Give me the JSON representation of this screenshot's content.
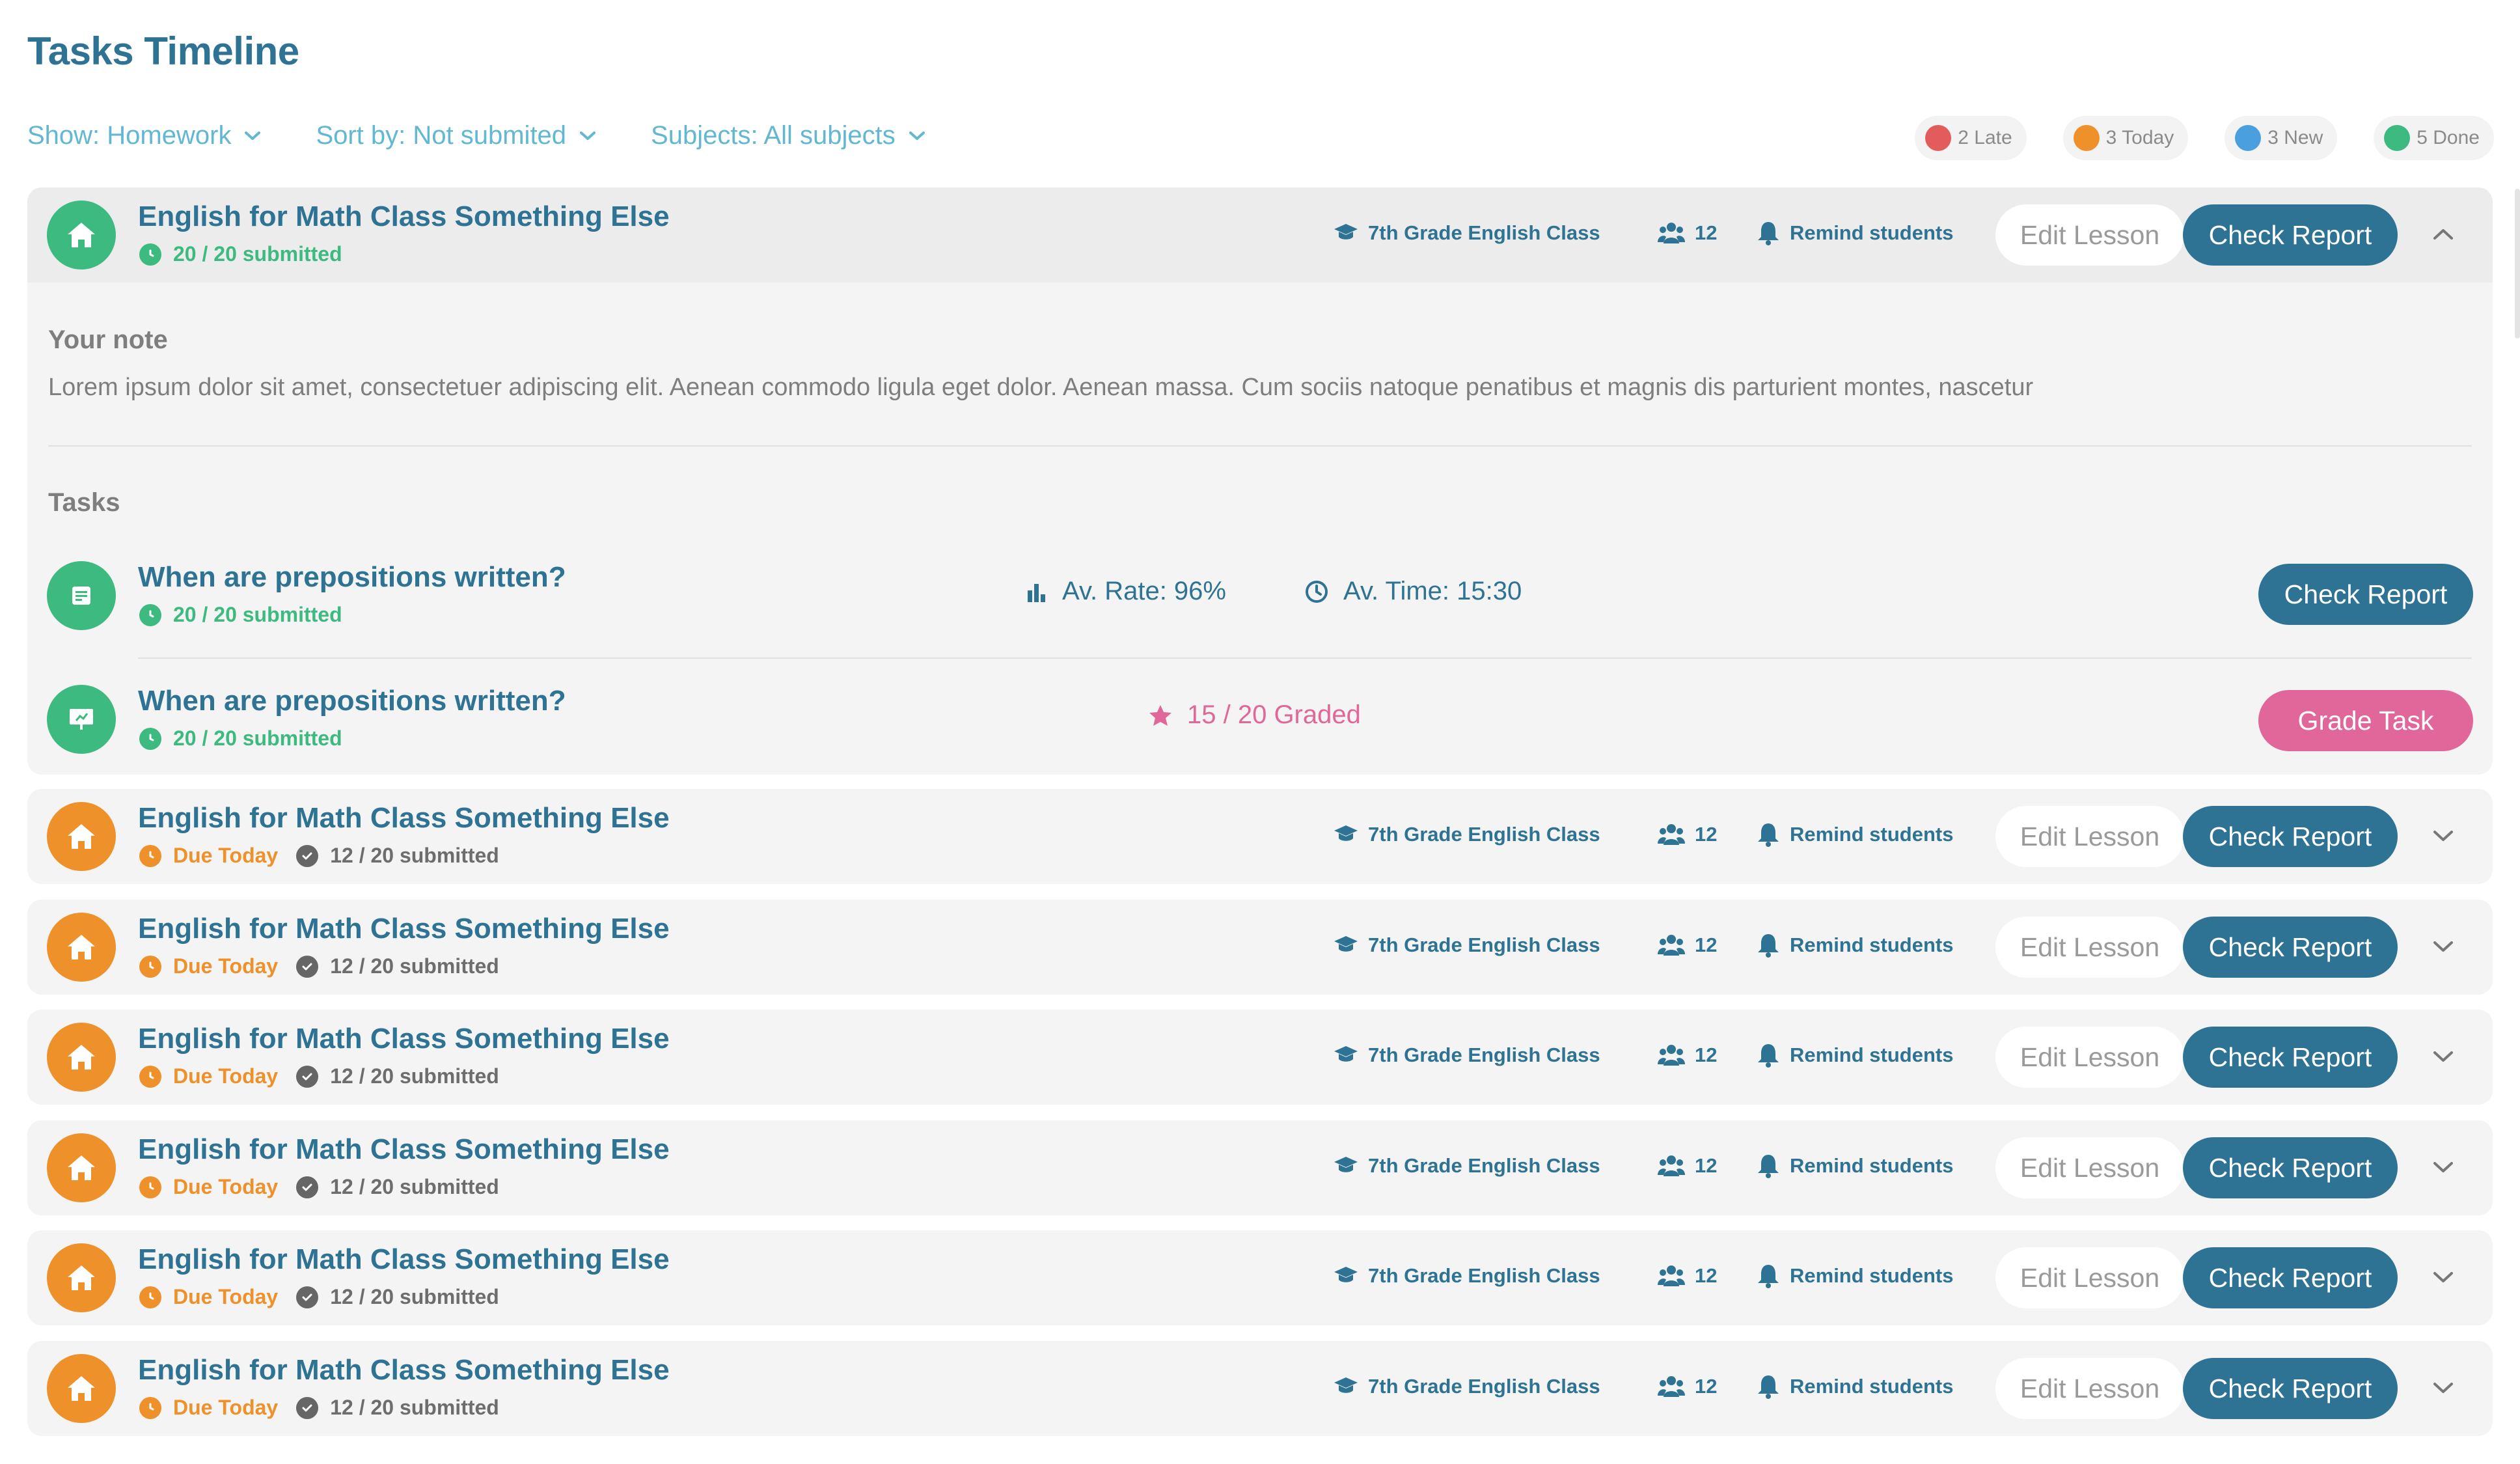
{
  "page_title": "Tasks Timeline",
  "filters": {
    "show": "Show: Homework",
    "sort": "Sort by: Not submited",
    "subjects": "Subjects: All subjects"
  },
  "legend": [
    {
      "label": "2 Late",
      "color": "#e45b5b"
    },
    {
      "label": "3 Today",
      "color": "#ee912b"
    },
    {
      "label": "3 New",
      "color": "#4a9fde"
    },
    {
      "label": "5 Done",
      "color": "#3dba7f"
    }
  ],
  "expanded_lesson": {
    "title": "English for Math Class Something Else",
    "submitted": "20 / 20 submitted",
    "class_name": "7th Grade English Class",
    "students": "12",
    "remind": "Remind students",
    "edit_label": "Edit Lesson",
    "check_label": "Check Report",
    "note_label": "Your note",
    "note_text": "Lorem ipsum dolor sit amet, consectetuer adipiscing elit. Aenean commodo ligula eget dolor. Aenean massa. Cum sociis natoque penatibus et magnis dis parturient montes, nascetur",
    "tasks_label": "Tasks",
    "tasks": [
      {
        "title": "When are prepositions written?",
        "submitted": "20 / 20 submitted",
        "rate": "Av. Rate: 96%",
        "time": "Av. Time: 15:30",
        "button": "Check Report"
      },
      {
        "title": "When are prepositions written?",
        "submitted": "20 / 20 submitted",
        "graded": "15 / 20 Graded",
        "button": "Grade Task"
      }
    ]
  },
  "lessons": [
    {
      "title": "English for Math Class Something Else",
      "due": "Due Today",
      "submitted": "12 / 20 submitted",
      "class_name": "7th Grade English Class",
      "students": "12",
      "remind": "Remind students",
      "edit_label": "Edit Lesson",
      "check_label": "Check Report"
    },
    {
      "title": "English for Math Class Something Else",
      "due": "Due Today",
      "submitted": "12 / 20 submitted",
      "class_name": "7th Grade English Class",
      "students": "12",
      "remind": "Remind students",
      "edit_label": "Edit Lesson",
      "check_label": "Check Report"
    },
    {
      "title": "English for Math Class Something Else",
      "due": "Due Today",
      "submitted": "12 / 20 submitted",
      "class_name": "7th Grade English Class",
      "students": "12",
      "remind": "Remind students",
      "edit_label": "Edit Lesson",
      "check_label": "Check Report"
    },
    {
      "title": "English for Math Class Something Else",
      "due": "Due Today",
      "submitted": "12 / 20 submitted",
      "class_name": "7th Grade English Class",
      "students": "12",
      "remind": "Remind students",
      "edit_label": "Edit Lesson",
      "check_label": "Check Report"
    },
    {
      "title": "English for Math Class Something Else",
      "due": "Due Today",
      "submitted": "12 / 20 submitted",
      "class_name": "7th Grade English Class",
      "students": "12",
      "remind": "Remind students",
      "edit_label": "Edit Lesson",
      "check_label": "Check Report"
    },
    {
      "title": "English for Math Class Something Else",
      "due": "Due Today",
      "submitted": "12 / 20 submitted",
      "class_name": "7th Grade English Class",
      "students": "12",
      "remind": "Remind students",
      "edit_label": "Edit Lesson",
      "check_label": "Check Report"
    }
  ],
  "icons": {
    "lesson": "home-icon",
    "task_quiz": "document-icon",
    "task_presentation": "presentation-icon",
    "class": "graduation-cap-icon",
    "students": "users-icon",
    "remind": "bell-icon",
    "expand": "chevron-down-icon",
    "collapse": "chevron-up-icon"
  }
}
